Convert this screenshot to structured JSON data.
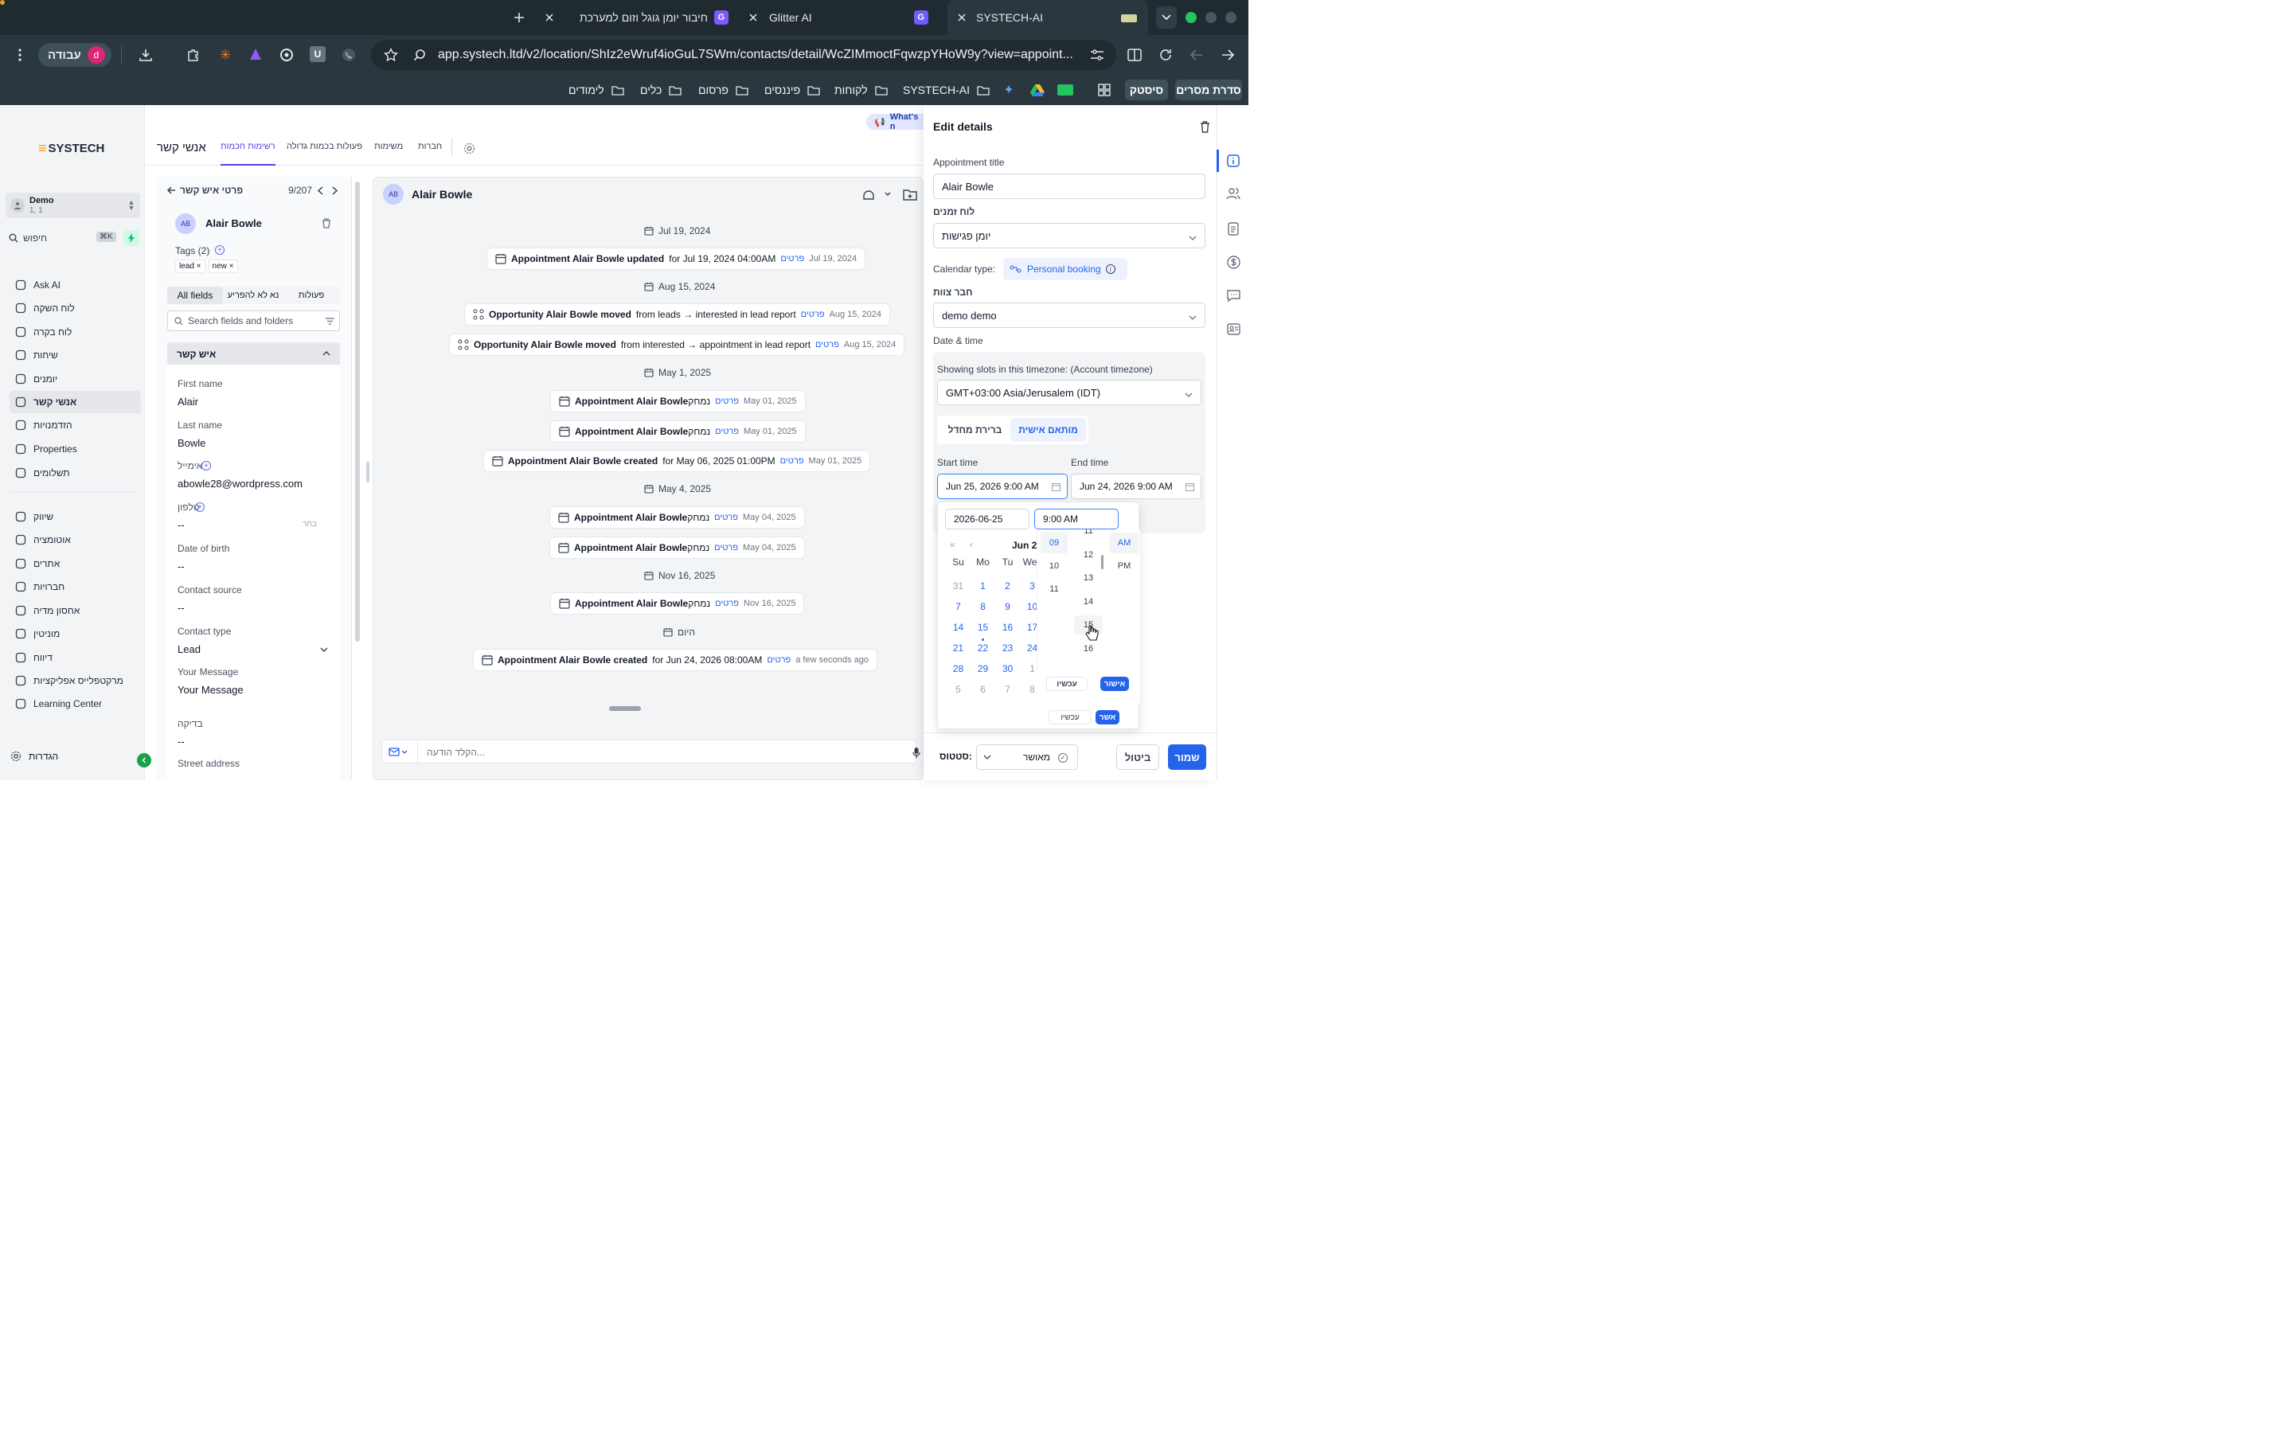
{
  "browser": {
    "tabs": [
      {
        "title": "SYSTECH-AI"
      },
      {
        "title": "Glitter AI"
      },
      {
        "title": "חיבור יומן גוגל וזום למערכת"
      }
    ],
    "profile_label": "עבודה",
    "profile_initial": "d",
    "url": "app.systech.ltd/v2/location/ShIz2eWruf4ioGuL7SWm/contacts/detail/WcZIMmoctFqwzpYHoW9y?view=appoint...",
    "bookmarks": [
      "סדרת מסרים",
      "סיסטק",
      "SYSTECH-AI",
      "לקוחות",
      "פיננסים",
      "פרסום",
      "כלים",
      "לימודים"
    ]
  },
  "sidebar": {
    "logo": "SYSTECH",
    "account_name": "Demo",
    "account_sub": "1, 1",
    "search_placeholder": "חיפוש",
    "search_shortcut": "⌘K",
    "items": [
      {
        "label": "Ask AI",
        "icon": "sparkle-icon"
      },
      {
        "label": "לוח השקה",
        "icon": "launch-icon"
      },
      {
        "label": "לוח בקרה",
        "icon": "dashboard-icon"
      },
      {
        "label": "שיחות",
        "icon": "chat-icon"
      },
      {
        "label": "יומנים",
        "icon": "calendar-icon"
      },
      {
        "label": "אנשי קשר",
        "icon": "contacts-icon"
      },
      {
        "label": "הזדמנויות",
        "icon": "opportunities-icon"
      },
      {
        "label": "Properties",
        "icon": "properties-icon"
      },
      {
        "label": "תשלומים",
        "icon": "payments-icon"
      },
      {
        "label": "שיווק",
        "icon": "megaphone-icon"
      },
      {
        "label": "אוטומציה",
        "icon": "automation-icon"
      },
      {
        "label": "אתרים",
        "icon": "globe-icon"
      },
      {
        "label": "חברויות",
        "icon": "membership-icon"
      },
      {
        "label": "אחסון מדיה",
        "icon": "media-icon"
      },
      {
        "label": "מוניטין",
        "icon": "reputation-icon"
      },
      {
        "label": "דיווח",
        "icon": "reporting-icon"
      },
      {
        "label": "מרקטפלייס אפליקציות",
        "icon": "marketplace-icon"
      },
      {
        "label": "Learning Center",
        "icon": "graduation-icon"
      }
    ],
    "settings_label": "הגדרות"
  },
  "topnav": {
    "title": "אנשי קשר",
    "tabs": [
      "רשימות חכמות",
      "פעולות בכמות גדולה",
      "משימות",
      "חברות"
    ]
  },
  "contact": {
    "header_title": "פרטי איש קשר",
    "counter": "9/207",
    "initials": "AB",
    "name": "Alair Bowle",
    "tags_label": "Tags (2)",
    "tags": [
      "lead",
      "new"
    ],
    "filter_tabs": [
      "All fields",
      "נא לא להפריע",
      "פעולות"
    ],
    "search_placeholder": "Search fields and folders",
    "section_title": "איש קשר",
    "fields": [
      {
        "label": "First name",
        "value": "Alair"
      },
      {
        "label": "Last name",
        "value": "Bowle"
      },
      {
        "label": "אימייל",
        "value": "abowle28@wordpress.com"
      },
      {
        "label": "טלפון",
        "value": "--",
        "extra": "בחר"
      },
      {
        "label": "Date of birth",
        "value": "--"
      },
      {
        "label": "Contact source",
        "value": "--"
      },
      {
        "label": "Contact type",
        "value": "Lead"
      },
      {
        "label": "Your Message",
        "value": "Your Message"
      },
      {
        "label": "בדיקה",
        "value": "--"
      },
      {
        "label": "Street address",
        "value": ""
      }
    ]
  },
  "feed": {
    "contact_initials": "AB",
    "contact_name": "Alair Bowle",
    "whats_new": "What's n",
    "details_link": "פרטים",
    "entries": [
      {
        "kind": "date",
        "text": "Jul 19, 2024"
      },
      {
        "kind": "event",
        "bold": "Appointment Alair Bowle updated",
        "rest": "for Jul 19, 2024 04:00AM",
        "date": "Jul 19, 2024"
      },
      {
        "kind": "date",
        "text": "Aug 15, 2024"
      },
      {
        "kind": "event",
        "bold": "Opportunity Alair Bowle moved",
        "rest": "from leads → interested in lead report",
        "date": "Aug 15, 2024"
      },
      {
        "kind": "event",
        "bold": "Opportunity Alair Bowle moved",
        "rest": "from interested → appointment in lead report",
        "date": "Aug 15, 2024"
      },
      {
        "kind": "date",
        "text": "May 1, 2025"
      },
      {
        "kind": "event",
        "bold": "Appointment Alair Bowle",
        "rest": "נמחק",
        "date": "May 01, 2025"
      },
      {
        "kind": "event",
        "bold": "Appointment Alair Bowle",
        "rest": "נמחק",
        "date": "May 01, 2025"
      },
      {
        "kind": "event",
        "bold": "Appointment Alair Bowle created",
        "rest": "for May 06, 2025 01:00PM",
        "date": "May 01, 2025"
      },
      {
        "kind": "date",
        "text": "May 4, 2025"
      },
      {
        "kind": "event",
        "bold": "Appointment Alair Bowle",
        "rest": "נמחק",
        "date": "May 04, 2025"
      },
      {
        "kind": "event",
        "bold": "Appointment Alair Bowle",
        "rest": "נמחק",
        "date": "May 04, 2025"
      },
      {
        "kind": "date",
        "text": "Nov 16, 2025"
      },
      {
        "kind": "event",
        "bold": "Appointment Alair Bowle",
        "rest": "נמחק",
        "date": "Nov 16, 2025"
      },
      {
        "kind": "date",
        "text": "היום"
      },
      {
        "kind": "event",
        "bold": "Appointment Alair Bowle created",
        "rest": "for Jun 24, 2026 08:00AM",
        "date": "a few seconds ago"
      }
    ],
    "composer_placeholder": "הקלד הודעה..."
  },
  "drawer": {
    "title": "Edit details",
    "appointment_title_label": "Appointment title",
    "appointment_title": "Alair Bowle",
    "calendar_label": "לוח זמנים",
    "calendar_value": "יומן פגישות",
    "calendar_type_label": "Calendar type:",
    "calendar_type_value": "Personal booking",
    "team_member_label": "חבר צוות",
    "team_member_value": "demo demo",
    "datetime_label": "Date & time",
    "timezone_note": "Showing slots in this timezone: (Account timezone)",
    "timezone_value": "GMT+03:00 Asia/Jerusalem (IDT)",
    "mode_tabs": [
      "ברירת מחדל",
      "מותאם אישית"
    ],
    "start_label": "Start time",
    "start_value": "Jun 25, 2026 9:00 AM",
    "end_label": "End time",
    "end_value": "Jun 24, 2026 9:00 AM",
    "status_label": "סטטוס:",
    "status_value": "מאושר",
    "cancel": "ביטול",
    "save": "שמור"
  },
  "picker": {
    "date_value": "2026-06-25",
    "time_value": "9:00 AM",
    "month_label": "Jun 2",
    "weekdays": [
      "Su",
      "Mo",
      "Tu",
      "We"
    ],
    "weeks": [
      [
        "31",
        "1",
        "2",
        "3"
      ],
      [
        "7",
        "8",
        "9",
        "10"
      ],
      [
        "14",
        "15",
        "16",
        "17"
      ],
      [
        "21",
        "22",
        "23",
        "24"
      ],
      [
        "28",
        "29",
        "30",
        "1"
      ],
      [
        "5",
        "6",
        "7",
        "8"
      ]
    ],
    "hours": [
      "09",
      "10",
      "11"
    ],
    "minutes": [
      "11",
      "12",
      "13",
      "14",
      "15",
      "16"
    ],
    "ampm": [
      "AM",
      "PM"
    ],
    "now_label": "עכשיו",
    "ok_label": "אישור",
    "outer_now": "עכשיו",
    "outer_ok": "אשר"
  }
}
